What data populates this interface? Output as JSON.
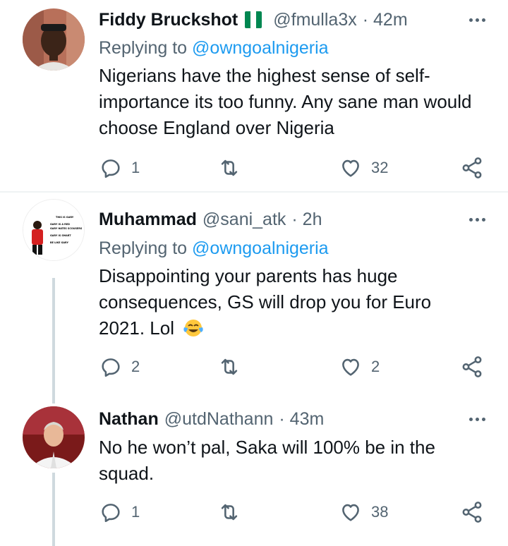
{
  "tweets": [
    {
      "name": "Fiddy Bruckshot",
      "handle": "@fmulla3x",
      "time": "· 42m",
      "replying_prefix": "Replying to ",
      "replying_to": "@owngoalnigeria",
      "text": "Nigerians have the highest sense of self-importance its too funny. Any sane man would choose England over Nigeria",
      "reply_count": "1",
      "retweet_count": "",
      "like_count": "32",
      "flag_colors": [
        "#008751",
        "#ffffff",
        "#008751"
      ]
    },
    {
      "name": "Muhammad",
      "handle": "@sani_atk",
      "time": "· 2h",
      "replying_prefix": "Replying to ",
      "replying_to": "@owngoalnigeria",
      "text": "Disappointing your parents has huge consequences, GS will drop you for Euro 2021. Lol",
      "emoji": "face-with-tears-of-joy-icon",
      "reply_count": "2",
      "retweet_count": "",
      "like_count": "2",
      "avatar_text": [
        "THIS IS GARY",
        "GARY IS A RED",
        "GARY HATES SCOUSERS",
        "GARY IS SMART",
        "BE LIKE GARY"
      ]
    },
    {
      "name": "Nathan",
      "handle": "@utdNathann",
      "time": "· 43m",
      "text": "No he won’t pal, Saka will 100% be in the squad.",
      "reply_count": "1",
      "retweet_count": "",
      "like_count": "38"
    }
  ],
  "colors": {
    "link": "#1d9bf0",
    "muted": "#536471",
    "divider": "#eff3f4"
  }
}
